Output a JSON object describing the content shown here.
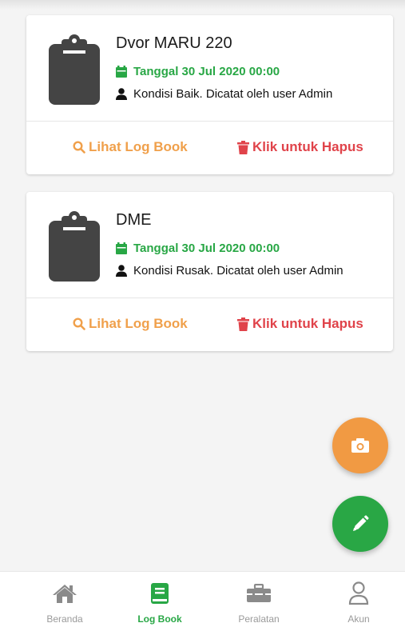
{
  "colors": {
    "success": "#28a745",
    "warning": "#f0a04b",
    "danger": "#e0434a",
    "icon_dark": "#444444",
    "fab_camera": "#f19a43",
    "fab_edit": "#29a745"
  },
  "logbook": {
    "entries": [
      {
        "title": "Dvor MARU 220",
        "date": "Tanggal 30 Jul 2020 00:00",
        "note": "Kondisi Baik. Dicatat oleh user Admin",
        "view_label": "Lihat Log Book",
        "delete_label": "Klik untuk Hapus",
        "icon": "clipboard-icon"
      },
      {
        "title": "DME",
        "date": "Tanggal 30 Jul 2020 00:00",
        "note": "Kondisi Rusak. Dicatat oleh user Admin",
        "view_label": "Lihat Log Book",
        "delete_label": "Klik untuk Hapus",
        "icon": "clipboard-icon"
      }
    ]
  },
  "fabs": {
    "camera_icon": "camera-icon",
    "edit_icon": "pencil-icon"
  },
  "bottom_nav": {
    "items": [
      {
        "label": "Beranda",
        "icon": "home-icon",
        "active": false
      },
      {
        "label": "Log Book",
        "icon": "book-icon",
        "active": true
      },
      {
        "label": "Peralatan",
        "icon": "toolbox-icon",
        "active": false
      },
      {
        "label": "Akun",
        "icon": "user-icon",
        "active": false
      }
    ]
  }
}
